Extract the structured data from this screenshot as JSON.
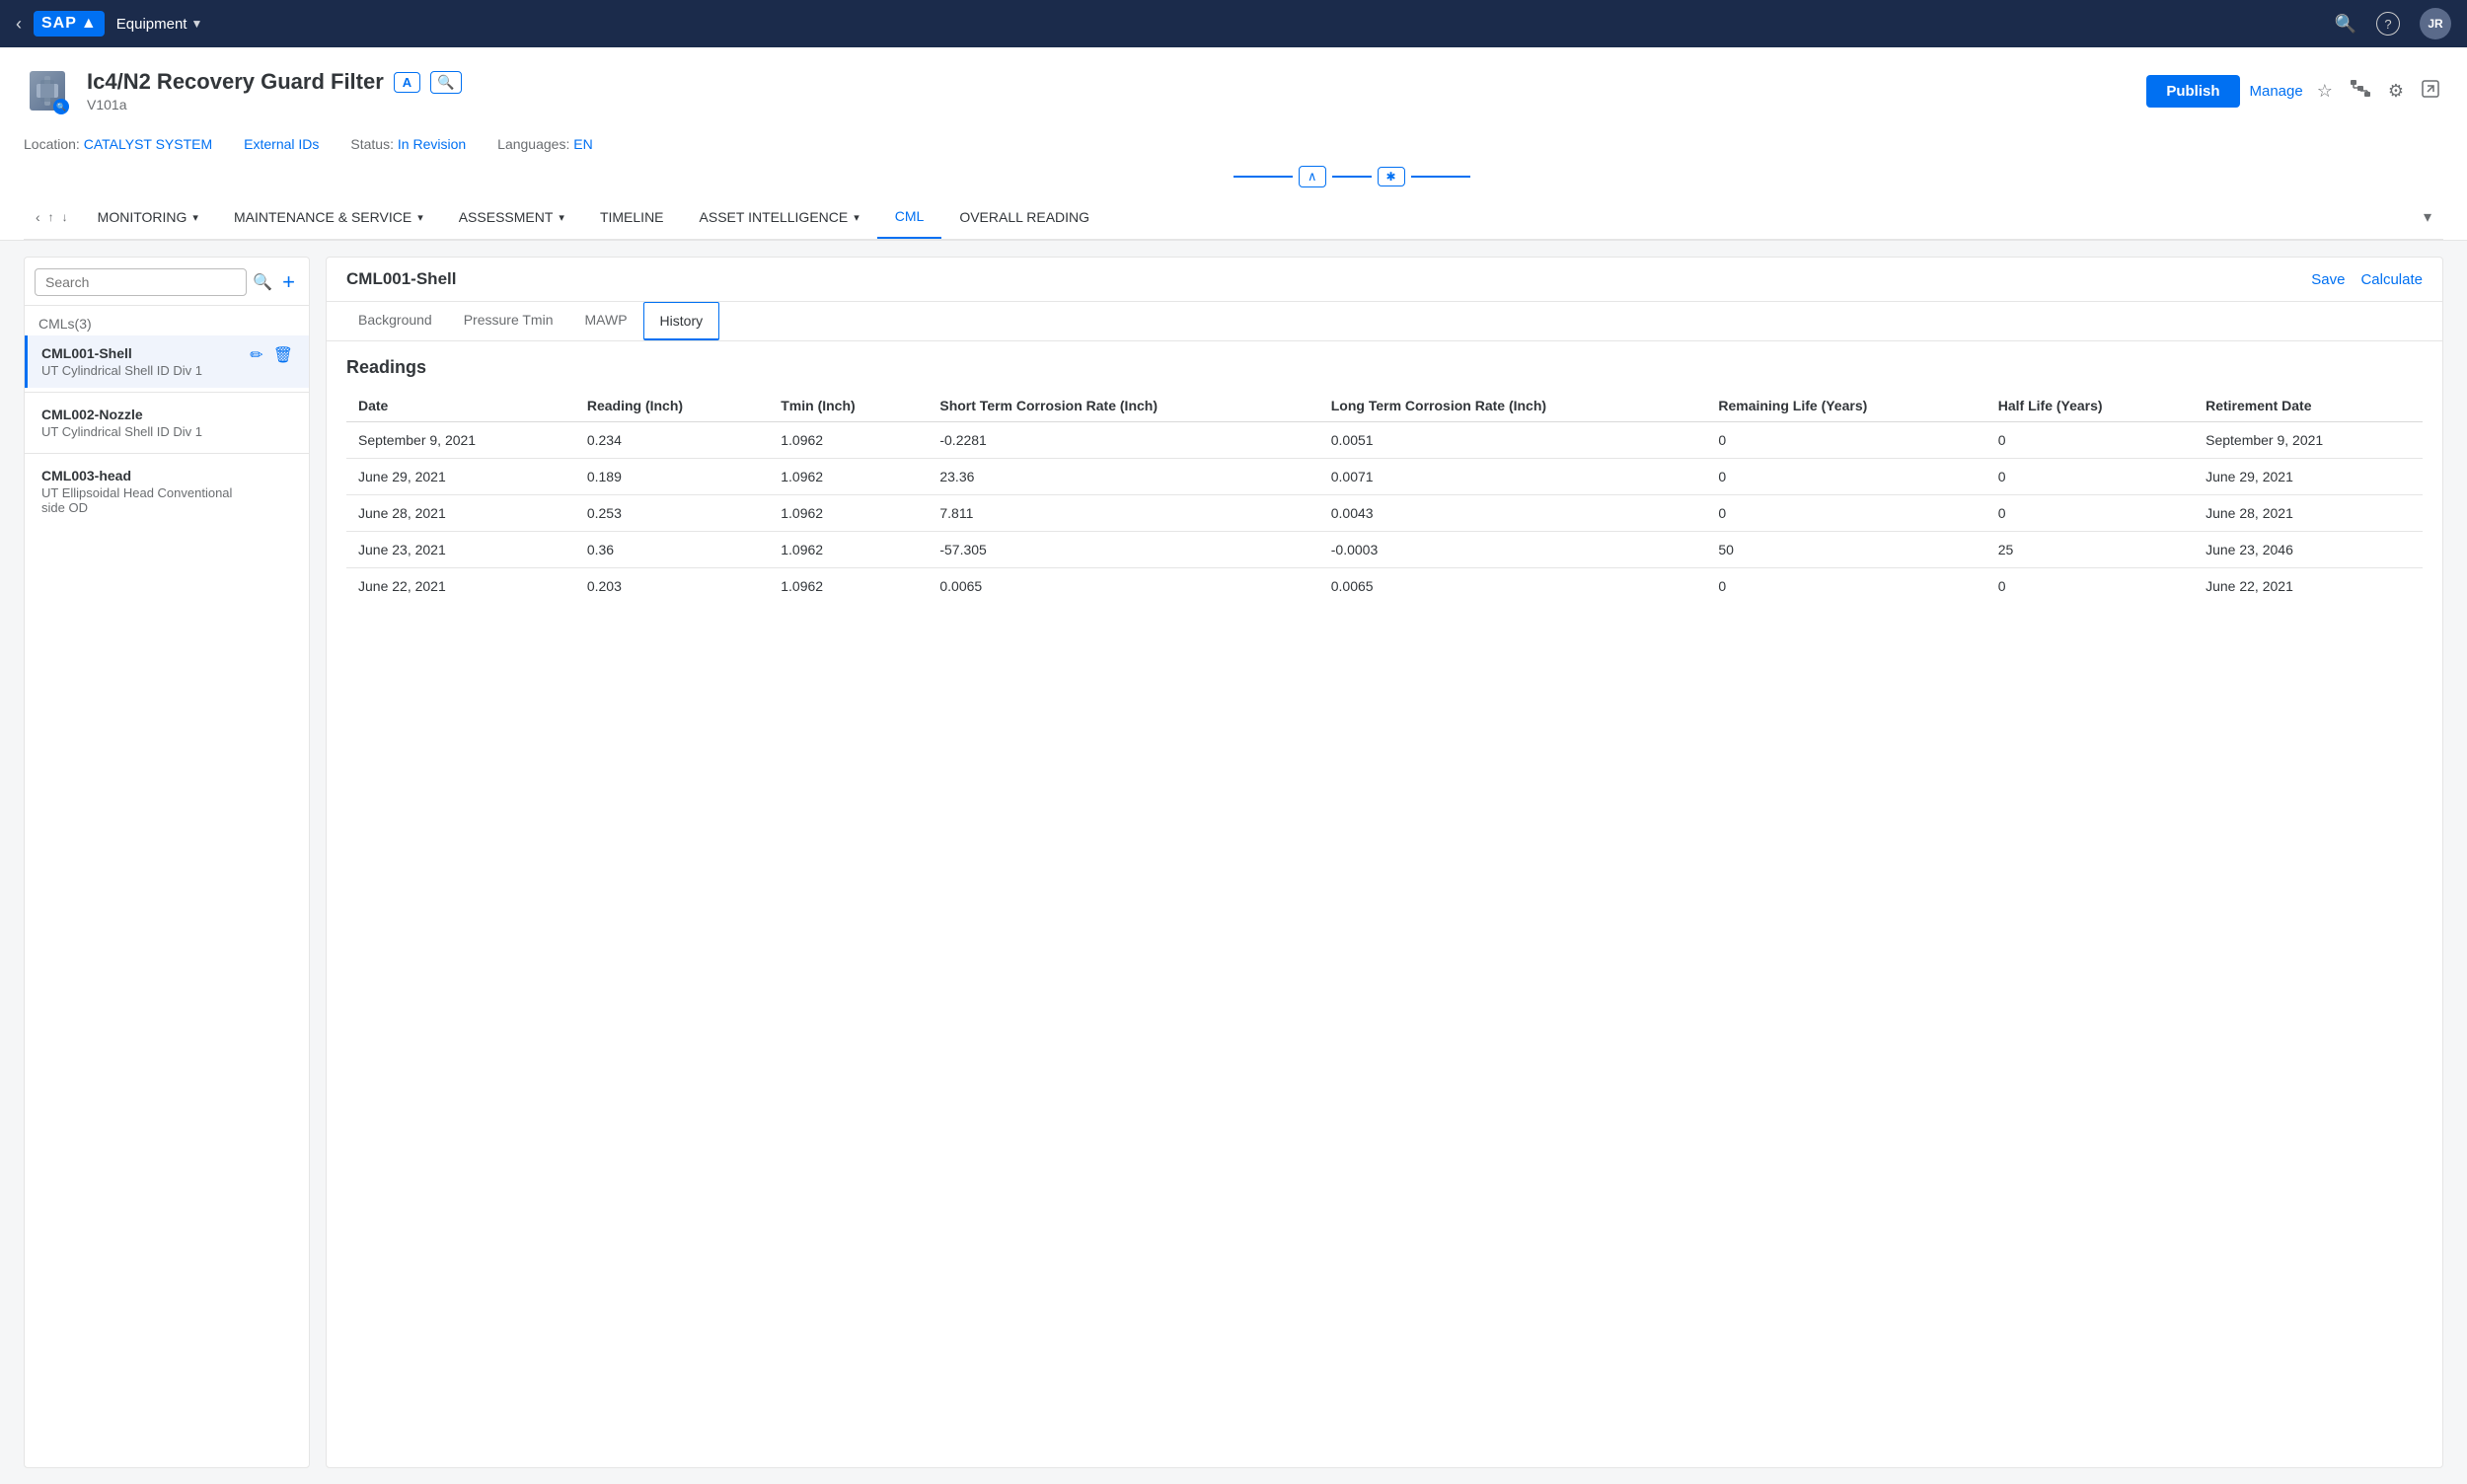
{
  "topNav": {
    "appTitle": "Equipment",
    "searchIcon": "🔍",
    "helpIcon": "?",
    "userInitials": "JR"
  },
  "objectHeader": {
    "title": "Ic4/N2 Recovery Guard Filter",
    "subtitle": "V101a",
    "badgeA": "A",
    "badgeSearch": "🔍",
    "publishLabel": "Publish",
    "manageLabel": "Manage",
    "location_label": "Location:",
    "location_value": "CATALYST SYSTEM",
    "externalIds": "External IDs",
    "status_label": "Status:",
    "status_value": "In Revision",
    "languages_label": "Languages:",
    "languages_value": "EN"
  },
  "tabs": [
    {
      "label": "MONITORING",
      "hasChevron": true
    },
    {
      "label": "MAINTENANCE & SERVICE",
      "hasChevron": true
    },
    {
      "label": "ASSESSMENT",
      "hasChevron": true
    },
    {
      "label": "TIMELINE",
      "hasChevron": false
    },
    {
      "label": "ASSET INTELLIGENCE",
      "hasChevron": true
    },
    {
      "label": "CML",
      "hasChevron": false,
      "active": true
    },
    {
      "label": "OVERALL READING",
      "hasChevron": false
    }
  ],
  "sidebar": {
    "searchPlaceholder": "Search",
    "groupLabel": "CMLs(3)",
    "items": [
      {
        "id": "CML001",
        "title": "CML001-Shell",
        "subtitle": "UT Cylindrical Shell ID Div 1",
        "active": true
      },
      {
        "id": "CML002",
        "title": "CML002-Nozzle",
        "subtitle": "UT Cylindrical Shell ID Div 1",
        "active": false
      },
      {
        "id": "CML003",
        "title": "CML003-head",
        "subtitle": "UT Ellipsoidal Head Conventional side OD",
        "active": false
      }
    ]
  },
  "panel": {
    "title": "CML001-Shell",
    "saveLabel": "Save",
    "calculateLabel": "Calculate",
    "subTabs": [
      {
        "label": "Background"
      },
      {
        "label": "Pressure Tmin"
      },
      {
        "label": "MAWP"
      },
      {
        "label": "History",
        "active": true
      }
    ],
    "readings": {
      "sectionTitle": "Readings",
      "columns": [
        "Date",
        "Reading (Inch)",
        "Tmin (Inch)",
        "Short Term Corrosion Rate (Inch)",
        "Long Term Corrosion Rate (Inch)",
        "Remaining Life (Years)",
        "Half Life (Years)",
        "Retirement Date"
      ],
      "rows": [
        {
          "date": "September 9, 2021",
          "reading": "0.234",
          "tmin": "1.0962",
          "shortTerm": "-0.2281",
          "longTerm": "0.0051",
          "remainingLife": "0",
          "halfLife": "0",
          "retirementDate": "September 9, 2021"
        },
        {
          "date": "June 29, 2021",
          "reading": "0.189",
          "tmin": "1.0962",
          "shortTerm": "23.36",
          "longTerm": "0.0071",
          "remainingLife": "0",
          "halfLife": "0",
          "retirementDate": "June 29, 2021"
        },
        {
          "date": "June 28, 2021",
          "reading": "0.253",
          "tmin": "1.0962",
          "shortTerm": "7.811",
          "longTerm": "0.0043",
          "remainingLife": "0",
          "halfLife": "0",
          "retirementDate": "June 28, 2021"
        },
        {
          "date": "June 23, 2021",
          "reading": "0.36",
          "tmin": "1.0962",
          "shortTerm": "-57.305",
          "longTerm": "-0.0003",
          "remainingLife": "50",
          "halfLife": "25",
          "retirementDate": "June 23, 2046"
        },
        {
          "date": "June 22, 2021",
          "reading": "0.203",
          "tmin": "1.0962",
          "shortTerm": "0.0065",
          "longTerm": "0.0065",
          "remainingLife": "0",
          "halfLife": "0",
          "retirementDate": "June 22, 2021"
        }
      ]
    }
  }
}
